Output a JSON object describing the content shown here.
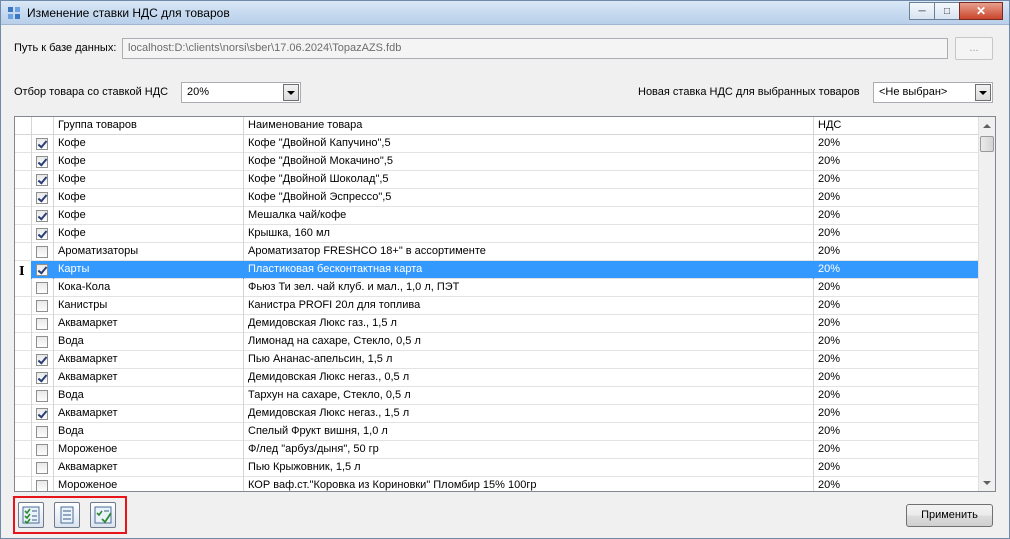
{
  "window": {
    "title": "Изменение ставки НДС для товаров"
  },
  "db_path": {
    "label": "Путь к базе данных:",
    "value": "localhost:D:\\clients\\norsi\\sber\\17.06.2024\\TopazAZS.fdb",
    "browse_label": "..."
  },
  "filter": {
    "label": "Отбор  товара со ставкой  НДС",
    "value": "20%"
  },
  "new_rate": {
    "label": "Новая ставка НДС для выбранных товаров",
    "value": "<Не выбран>"
  },
  "grid": {
    "columns": {
      "group": "Группа товаров",
      "name": "Наименование товара",
      "vat": "НДС"
    },
    "rows": [
      {
        "checked": true,
        "group": "Кофе",
        "name": "Кофе \"Двойной Капучино\",5",
        "vat": "20%"
      },
      {
        "checked": true,
        "group": "Кофе",
        "name": "Кофе \"Двойной Мокачино\",5",
        "vat": "20%"
      },
      {
        "checked": true,
        "group": "Кофе",
        "name": "Кофе \"Двойной Шоколад\",5",
        "vat": "20%"
      },
      {
        "checked": true,
        "group": "Кофе",
        "name": "Кофе \"Двойной Эспрессо\",5",
        "vat": "20%"
      },
      {
        "checked": true,
        "group": "Кофе",
        "name": "Мешалка чай/кофе",
        "vat": "20%"
      },
      {
        "checked": true,
        "group": "Кофе",
        "name": "Крышка, 160 мл",
        "vat": "20%"
      },
      {
        "checked": false,
        "group": "Ароматизаторы",
        "name": "Ароматизатор FRESHCO 18+\" в ассортименте",
        "vat": "20%"
      },
      {
        "checked": true,
        "group": "Карты",
        "name": "Пластиковая бесконтактная карта",
        "vat": "20%",
        "selected": true
      },
      {
        "checked": false,
        "group": "Кока-Кола",
        "name": "Фьюз Ти зел. чай клуб. и мал., 1,0 л, ПЭТ",
        "vat": "20%"
      },
      {
        "checked": false,
        "group": "Канистры",
        "name": "Канистра PROFI 20л для топлива",
        "vat": "20%"
      },
      {
        "checked": false,
        "group": "Аквамаркет",
        "name": "Демидовская Люкс газ., 1,5 л",
        "vat": "20%"
      },
      {
        "checked": false,
        "group": "Вода",
        "name": "Лимонад на сахаре, Стекло, 0,5 л",
        "vat": "20%"
      },
      {
        "checked": true,
        "group": "Аквамаркет",
        "name": "Пью Ананас-апельсин, 1,5 л",
        "vat": "20%"
      },
      {
        "checked": true,
        "group": "Аквамаркет",
        "name": "Демидовская Люкс негаз., 0,5 л",
        "vat": "20%"
      },
      {
        "checked": false,
        "group": "Вода",
        "name": "Тархун на сахаре, Стекло, 0,5 л",
        "vat": "20%"
      },
      {
        "checked": true,
        "group": "Аквамаркет",
        "name": "Демидовская Люкс негаз., 1,5 л",
        "vat": "20%"
      },
      {
        "checked": false,
        "group": "Вода",
        "name": "Спелый Фрукт вишня, 1,0 л",
        "vat": "20%"
      },
      {
        "checked": false,
        "group": "Мороженое",
        "name": "Ф/лед \"арбуз/дыня\", 50 гр",
        "vat": "20%"
      },
      {
        "checked": false,
        "group": "Аквамаркет",
        "name": "Пью Крыжовник, 1,5 л",
        "vat": "20%"
      },
      {
        "checked": false,
        "group": "Мороженое",
        "name": "КОР ваф.ст.\"Коровка из Кориновки\" Пломбир 15% 100гр",
        "vat": "20%"
      }
    ]
  },
  "toolbar": {
    "icons": [
      "check-all-icon",
      "uncheck-all-icon",
      "invert-check-icon"
    ]
  },
  "apply_button": {
    "label": "Применить"
  },
  "colors": {
    "selection": "#3399ff",
    "highlight_frame": "#e8141c"
  }
}
